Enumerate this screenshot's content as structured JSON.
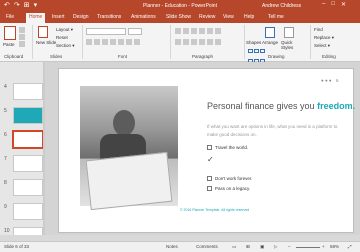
{
  "window": {
    "title": "Planner - Education  -  PowerPoint",
    "user": "Andrew Childress",
    "controls": [
      "–",
      "□",
      "✕"
    ]
  },
  "qat": [
    "↶",
    "↷",
    "⊞",
    "▾"
  ],
  "tabs": [
    "File",
    "Home",
    "Insert",
    "Design",
    "Transitions",
    "Animations",
    "Slide Show",
    "Review",
    "View",
    "Help",
    "Tell me"
  ],
  "ribbon": {
    "clipboard": {
      "label": "Clipboard",
      "paste": "Paste"
    },
    "slides": {
      "label": "Slides",
      "new_slide": "New Slide",
      "layout": "Layout ▾",
      "reset": "Reset",
      "section": "Section ▾"
    },
    "font": {
      "label": "Font"
    },
    "paragraph": {
      "label": "Paragraph"
    },
    "drawing": {
      "label": "Drawing",
      "shapes": "Shapes",
      "arrange": "Arrange",
      "quick_styles": "Quick Styles"
    },
    "editing": {
      "label": "Editing",
      "find": "Find",
      "replace": "Replace ▾",
      "select": "Select ▾"
    }
  },
  "thumbnails": {
    "numbers": [
      "4",
      "5",
      "6",
      "7",
      "8",
      "9",
      "10"
    ],
    "selected": "6"
  },
  "slide": {
    "headline_text": "Personal finance gives you ",
    "headline_accent": "freedom.",
    "subtext": "If what you want are options in life, what you need is a platform to make good decisions on.",
    "goals": [
      "Travel the world.",
      "Don't work forever.",
      "Pass on a legacy."
    ],
    "checkmark": "✓",
    "footer": "© 2016 Planner Template. All rights reserved",
    "page_dots": "● ● ●",
    "page_number": "6"
  },
  "status": {
    "slide_of": "Slide 6 of 33",
    "notes": "Notes",
    "comments": "Comments",
    "zoom": "58%"
  },
  "colors": {
    "accent": "#b7472a",
    "freedom": "#1fa8b5"
  }
}
